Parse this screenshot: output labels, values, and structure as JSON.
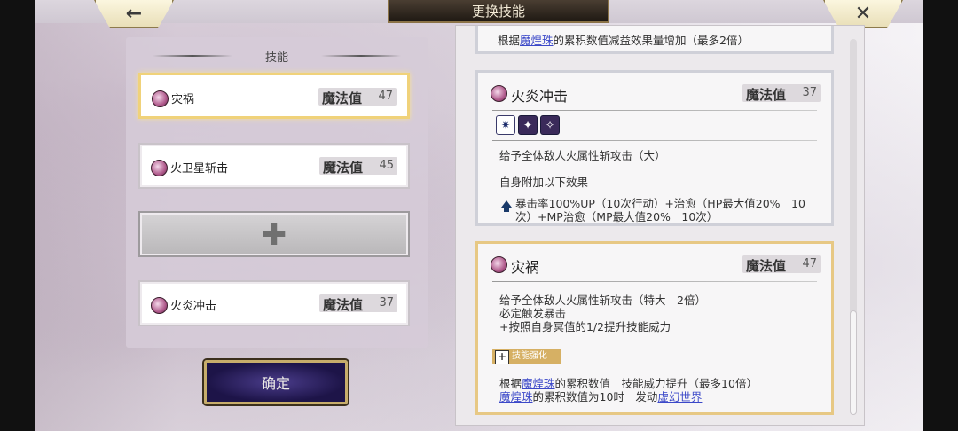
{
  "header": {
    "title": "更换技能",
    "back_icon": "←",
    "close_icon": "✕"
  },
  "left": {
    "section_title": "技能",
    "slots": [
      {
        "name": "灾祸",
        "mp_label": "魔法值",
        "mp": "47",
        "selected": true
      },
      {
        "name": "火卫星斩击",
        "mp_label": "魔法值",
        "mp": "45"
      },
      {
        "empty": true,
        "plus": "✚"
      },
      {
        "name": "火炎冲击",
        "mp_label": "魔法值",
        "mp": "37"
      }
    ],
    "confirm_label": "确定"
  },
  "right": {
    "prev_card_tail": {
      "pre": "根据",
      "link": "魔煌珠",
      "post": "的累积数值减益效果量增加（最多2倍）"
    },
    "cards": [
      {
        "name": "火炎冲击",
        "mp_label": "魔法值",
        "mp": "37",
        "desc1": "给予全体敌人火属性斩攻击（大）",
        "desc2": "自身附加以下效果",
        "buff_line1": "暴击率100%UP（10次行动）+治愈（HP最大值20%　10",
        "buff_line2": "次）+MP治愈（MP最大值20%　10次）"
      },
      {
        "name": "灾祸",
        "mp_label": "魔法值",
        "mp": "47",
        "desc1": "给予全体敌人火属性斩攻击（特大　2倍）",
        "desc2": "必定触发暴击",
        "desc3": "+按照自身冥值的1/2提升技能威力",
        "badge": "技能强化",
        "boost_pre": "根据",
        "boost_link": "魔煌珠",
        "boost_post": "的累积数值　技能威力提升（最多10倍）",
        "trigger_link": "魔煌珠",
        "trigger_mid": "的累积数值为10时　发动",
        "trigger_link2": "虚幻世界"
      }
    ]
  },
  "colors": {
    "accent_gold": "#e7c884",
    "link_blue": "#3b48c8",
    "confirm_purple": "#2d2163"
  }
}
